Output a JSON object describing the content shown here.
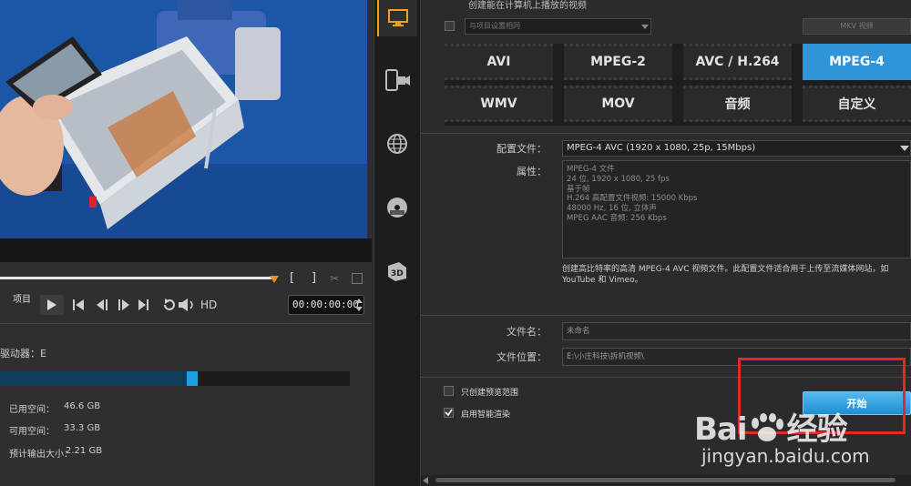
{
  "header": {
    "top_text": "创建能在计算机上播放的视频"
  },
  "options": {
    "match_project": "与项目设置相同",
    "top_right_btn": "MKV 视频"
  },
  "formats": [
    {
      "label": "AVI",
      "selected": false
    },
    {
      "label": "MPEG-2",
      "selected": false
    },
    {
      "label": "AVC / H.264",
      "selected": false
    },
    {
      "label": "MPEG-4",
      "selected": true
    },
    {
      "label": "WMV",
      "selected": false
    },
    {
      "label": "MOV",
      "selected": false
    },
    {
      "label": "音频",
      "selected": false
    },
    {
      "label": "自定义",
      "selected": false
    }
  ],
  "profile": {
    "label": "配置文件：",
    "value": "MPEG-4 AVC (1920 x 1080, 25p, 15Mbps)",
    "props_label": "属性：",
    "props_lines": [
      "MPEG-4 文件",
      "24 位, 1920 x 1080, 25 fps",
      "基于帧",
      "H.264 高配置文件视频: 15000 Kbps",
      "48000 Hz, 16 位, 立体声",
      "MPEG AAC 音频: 256 Kbps"
    ],
    "description": "创建高比特率的高清 MPEG-4 AVC 视频文件。此配置文件适合用于上传至流媒体网站，如 YouTube 和 Vimeo。"
  },
  "file": {
    "name_label": "文件名：",
    "name_value": "未命名",
    "location_label": "文件位置：",
    "location_value": "E:\\小庄科技\\拆机视频\\"
  },
  "checks": {
    "preview_only": "只创建预览范围",
    "smart_render": "启用智能渲染",
    "smart_render_checked": true
  },
  "start_button": "开始",
  "player": {
    "mode_label": "项目",
    "hd_label": "HD",
    "timecode": "00:00:00:00",
    "mark_in": "[",
    "mark_out": "]"
  },
  "drive": {
    "title": "驱动器：E",
    "used_label": "已用空间：",
    "used_value": "46.6 GB",
    "free_label": "可用空间：",
    "free_value": "33.3 GB",
    "estimate_label": "预计输出大小：",
    "estimate_value": "2.21 GB",
    "used_fraction": 0.53
  },
  "rail_icons": [
    "computer-icon",
    "device-icon",
    "web-icon",
    "disc-icon",
    "3d-icon"
  ],
  "watermark": {
    "brand": "Bai",
    "brand2": "经验",
    "url": "jingyan.baidu.com"
  },
  "colors": {
    "accent": "#2f94d8",
    "orange": "#f2a020",
    "highlight_box": "#e02a2a"
  }
}
